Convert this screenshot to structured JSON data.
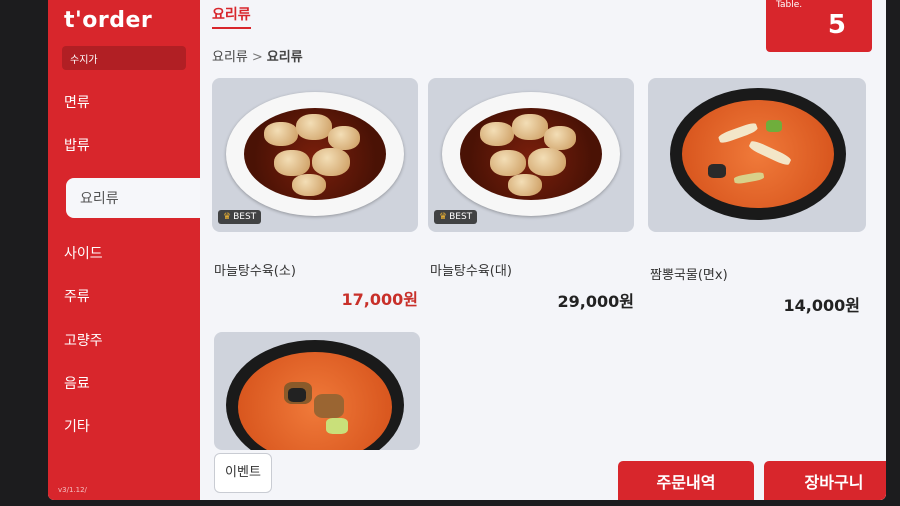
{
  "brand": {
    "logo": "t'order",
    "sub_label": "수지가"
  },
  "sidebar": {
    "items": [
      {
        "label": "면류"
      },
      {
        "label": "밥류"
      },
      {
        "label": "요리류"
      },
      {
        "label": "사이드"
      },
      {
        "label": "주류"
      },
      {
        "label": "고량주"
      },
      {
        "label": "음료"
      },
      {
        "label": "기타"
      }
    ],
    "active_index": 2,
    "footer": "v3/1.12/"
  },
  "header": {
    "category_tab": "요리류",
    "breadcrumb": [
      "요리류",
      "요리류"
    ],
    "breadcrumb_sep": ">",
    "table_label": "Table.",
    "table_number": "5"
  },
  "menu": [
    {
      "name": "마늘탕수육(소)",
      "price": "17,000원",
      "badge": "BEST",
      "image": "sweet-sour-pork-dish"
    },
    {
      "name": "마늘탕수육(대)",
      "price": "29,000원",
      "badge": "BEST",
      "image": "sweet-sour-pork-dish"
    },
    {
      "name": "짬뽕국물(면x)",
      "price": "14,000원",
      "badge": "",
      "image": "seafood-soup-bowl"
    },
    {
      "name": "",
      "price": "",
      "badge": "",
      "image": "spicy-soup-bowl"
    }
  ],
  "footer": {
    "event_label": "이벤트",
    "order_history_label": "주문내역",
    "cart_label": "장바구니"
  },
  "colors": {
    "brand_red": "#d8262c",
    "background": "#f4f5f9"
  }
}
